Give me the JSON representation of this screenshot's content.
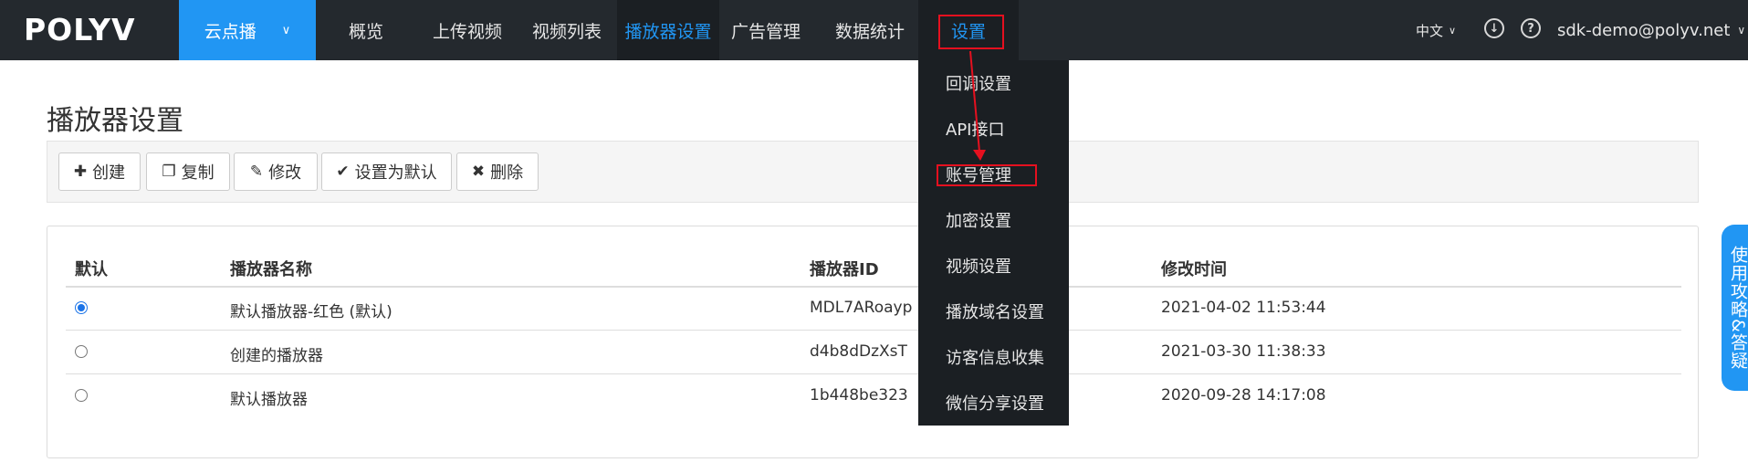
{
  "header": {
    "logo": "POLYV",
    "product": "云点播",
    "nav": [
      "概览",
      "上传视频",
      "视频列表",
      "播放器设置",
      "广告管理",
      "数据统计",
      "设置"
    ],
    "language": "中文",
    "user_email": "sdk-demo@polyv.net"
  },
  "settings_menu": {
    "items": [
      "回调设置",
      "API接口",
      "账号管理",
      "加密设置",
      "视频设置",
      "播放域名设置",
      "访客信息收集",
      "微信分享设置"
    ]
  },
  "page": {
    "title": "播放器设置"
  },
  "toolbar": {
    "create": "创建",
    "copy": "复制",
    "edit": "修改",
    "set_default": "设置为默认",
    "delete": "删除"
  },
  "table": {
    "columns": [
      "默认",
      "播放器名称",
      "播放器ID",
      "修改时间"
    ],
    "rows": [
      {
        "default": true,
        "name": "默认播放器-红色 (默认)",
        "id": "MDL7ARoayp",
        "modified": "2021-04-02 11:53:44"
      },
      {
        "default": false,
        "name": "创建的播放器",
        "id": "d4b8dDzXsT",
        "modified": "2021-03-30 11:38:33"
      },
      {
        "default": false,
        "name": "默认播放器",
        "id": "1b448be323",
        "modified": "2020-09-28 14:17:08"
      }
    ]
  },
  "help_tab": "使用攻略&答疑",
  "colors": {
    "topbar": "#24292e",
    "accent": "#2196f3",
    "highlight": "#e5101f"
  }
}
